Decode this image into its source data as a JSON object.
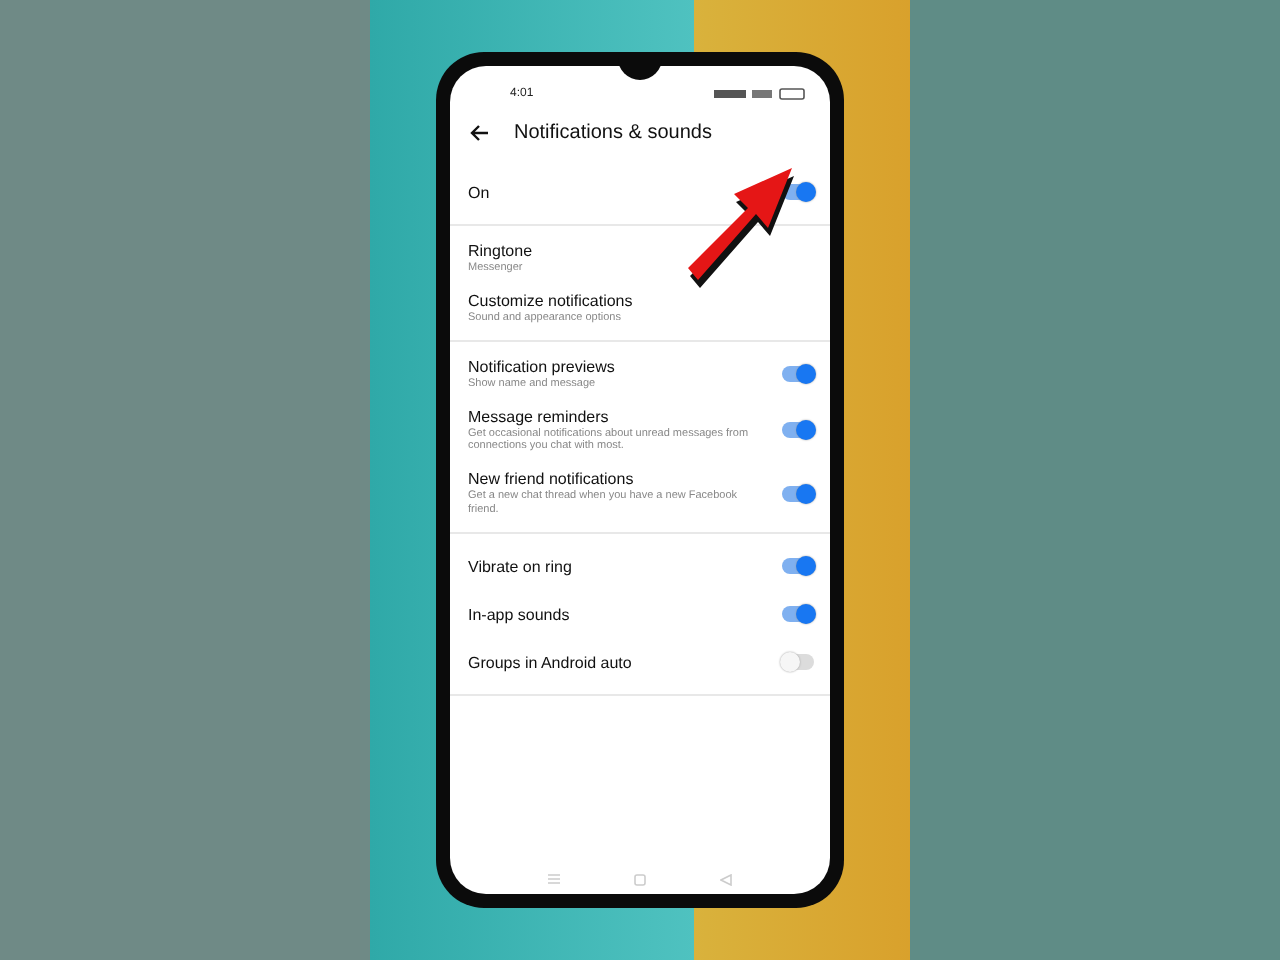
{
  "status_bar": {
    "time": "4:01"
  },
  "header": {
    "title": "Notifications & sounds"
  },
  "sections": [
    {
      "rows": [
        {
          "kind": "toggle",
          "title": "On",
          "on": true
        }
      ]
    },
    {
      "rows": [
        {
          "kind": "link",
          "title": "Ringtone",
          "subtitle": "Messenger"
        },
        {
          "kind": "link",
          "title": "Customize notifications",
          "subtitle": "Sound and appearance options"
        }
      ]
    },
    {
      "rows": [
        {
          "kind": "toggle",
          "title": "Notification previews",
          "subtitle": "Show name and message",
          "on": true
        },
        {
          "kind": "toggle",
          "title": "Message reminders",
          "subtitle": "Get occasional notifications about unread messages from connections you chat with most.",
          "on": true
        },
        {
          "kind": "toggle",
          "title": "New friend notifications",
          "subtitle": "Get a new chat thread when you have a new Facebook friend.",
          "on": true
        }
      ]
    },
    {
      "rows": [
        {
          "kind": "toggle",
          "title": "Vibrate on ring",
          "on": true
        },
        {
          "kind": "toggle",
          "title": "In-app sounds",
          "on": true
        },
        {
          "kind": "toggle",
          "title": "Groups in Android auto",
          "on": false
        }
      ]
    }
  ]
}
